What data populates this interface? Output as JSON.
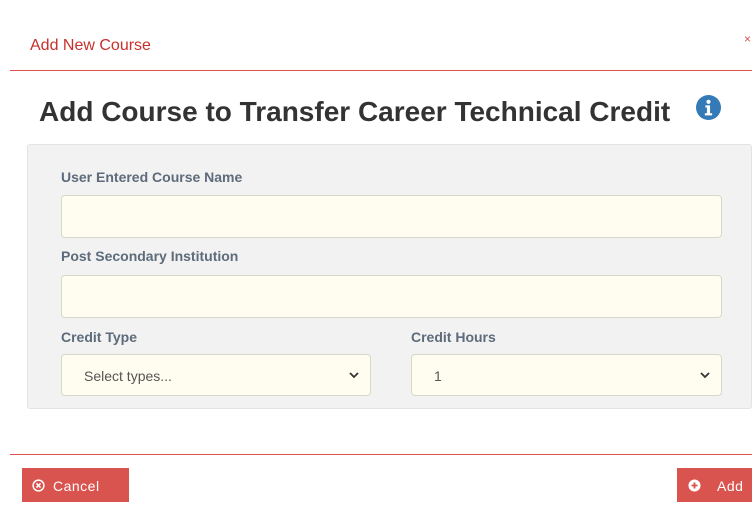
{
  "modal": {
    "title": "Add New Course",
    "close_label": "×"
  },
  "section": {
    "title": "Add Course to Transfer Career Technical Credit",
    "info_icon": "info-circle-icon"
  },
  "form": {
    "course_name": {
      "label": "User Entered Course Name",
      "value": "",
      "placeholder": ""
    },
    "institution": {
      "label": "Post Secondary Institution",
      "value": "",
      "placeholder": ""
    },
    "credit_type": {
      "label": "Credit Type",
      "selected": "Select types..."
    },
    "credit_hours": {
      "label": "Credit Hours",
      "selected": "1"
    }
  },
  "footer": {
    "cancel_label": "Cancel",
    "add_label": "Add",
    "cancel_icon": "times-circle-icon",
    "add_icon": "plus-circle-icon"
  },
  "colors": {
    "accent": "#d9534f",
    "title_red": "#c9302c",
    "label": "#5d6b7a",
    "info_blue": "#337ab7",
    "input_bg": "#fffdf0",
    "panel_bg": "#f2f2f2"
  }
}
